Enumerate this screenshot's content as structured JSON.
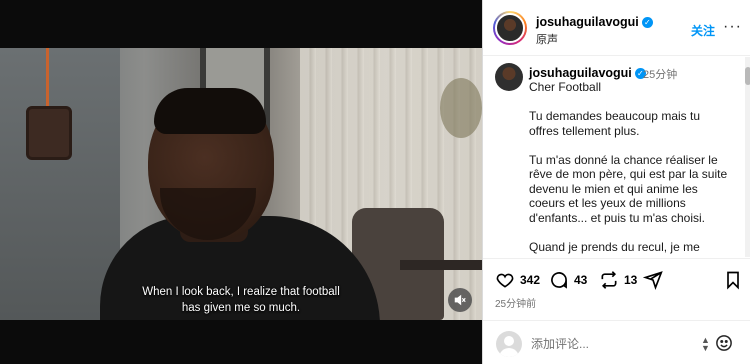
{
  "video": {
    "subtitle_line1": "When I look back, I realize that football",
    "subtitle_line2": "has given me so much.",
    "muted": true
  },
  "header": {
    "username": "josuhaguilavogui",
    "verified_mark": "✓",
    "audio_label": "原声",
    "follow_label": "关注",
    "more_label": "···"
  },
  "caption": {
    "username": "josuhaguilavogui",
    "verified_mark": "✓",
    "time": "25分钟",
    "paragraphs": [
      "Cher Football",
      "Tu demandes beaucoup mais tu offres tellement plus.",
      "Tu m'as donné la chance réaliser le rêve de mon père, qui est par la suite devenu le mien et qui anime les coeurs et les yeux de millions d'enfants... et puis tu m'as choisi.",
      "Quand je prends du recul, je me"
    ]
  },
  "actions": {
    "likes": "342",
    "comments": "43",
    "reposts": "13"
  },
  "time_ago": "25分钟前",
  "comment_bar": {
    "placeholder": "添加评论...",
    "stepper_up": "▲",
    "stepper_down": "▼"
  },
  "colors": {
    "accent": "#0095f6",
    "text_muted": "#737373",
    "video_bg": "#0b0b0b"
  },
  "icons": [
    "volume-muted-icon",
    "verified-badge-icon",
    "heart-icon",
    "comment-icon",
    "repost-icon",
    "share-icon",
    "bookmark-icon",
    "emoji-icon"
  ]
}
